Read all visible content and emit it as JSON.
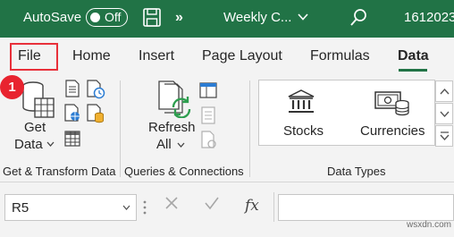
{
  "titlebar": {
    "autosave_label": "AutoSave",
    "toggle_text": "Off",
    "overflow_label": "»",
    "document_title": "Weekly C...",
    "user_text": "1612023"
  },
  "tabs": [
    {
      "label": "File",
      "active": false
    },
    {
      "label": "Home",
      "active": false
    },
    {
      "label": "Insert",
      "active": false
    },
    {
      "label": "Page Layout",
      "active": false
    },
    {
      "label": "Formulas",
      "active": false
    },
    {
      "label": "Data",
      "active": true
    }
  ],
  "annotation_badge": "1",
  "ribbon": {
    "get_data": {
      "line1": "Get",
      "line2": "Data"
    },
    "refresh_all": {
      "line1": "Refresh",
      "line2": "All"
    },
    "data_types": {
      "stocks": "Stocks",
      "currencies": "Currencies"
    },
    "groups": {
      "get_transform": "Get & Transform Data",
      "queries": "Queries & Connections",
      "data_types": "Data Types"
    }
  },
  "formula_bar": {
    "name_box_value": "R5",
    "fx_label": "fx",
    "formula_value": ""
  },
  "watermark": "wsxdn.com",
  "colors": {
    "titlebar": "#217346",
    "highlight": "#e8303a",
    "ribbon_bg": "#f3f3f3"
  }
}
